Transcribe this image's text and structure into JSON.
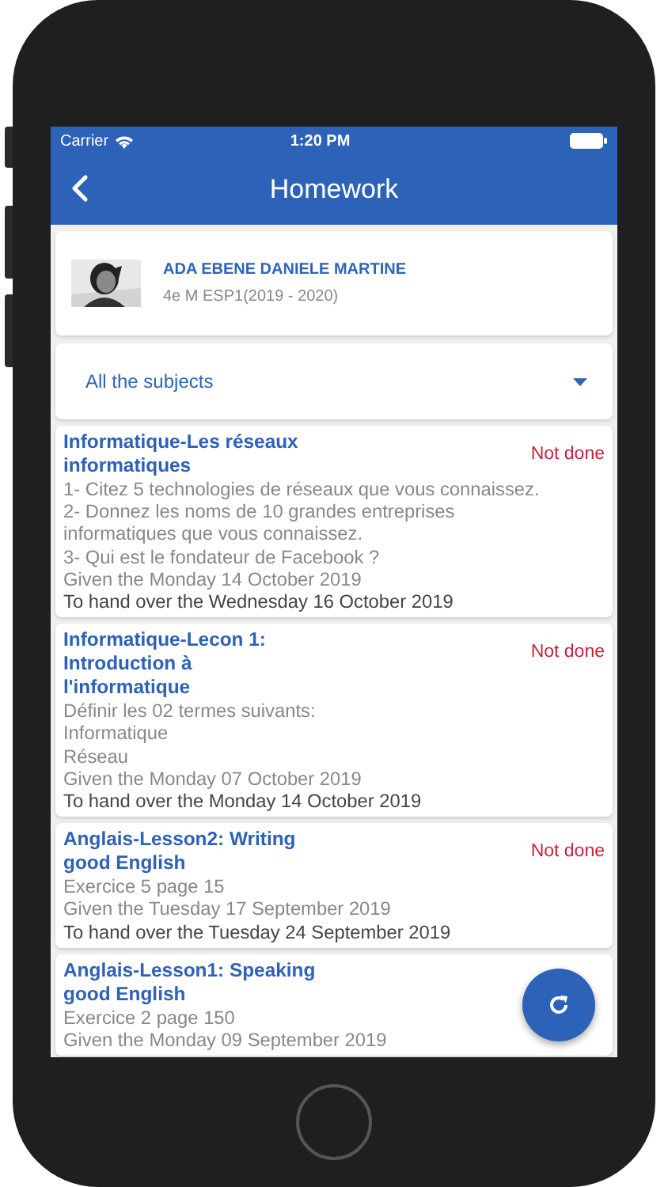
{
  "status_bar": {
    "carrier": "Carrier",
    "time": "1:20 PM"
  },
  "nav": {
    "title": "Homework"
  },
  "student": {
    "name": "ADA EBENE DANIELE MARTINE",
    "class": "4e M ESP1(2019 - 2020)"
  },
  "filter": {
    "value": "All the subjects"
  },
  "homework": [
    {
      "title": "Informatique-Les réseaux informatiques",
      "status": "Not done",
      "details": [
        "1- Citez 5 technologies de réseaux que vous connaissez.",
        "2- Donnez les noms de 10 grandes entreprises informatiques que vous connaissez.",
        "3- Qui est le fondateur de Facebook ?"
      ],
      "given": "Given the Monday 14 October 2019",
      "due": "To hand over the Wednesday 16 October 2019"
    },
    {
      "title": "Informatique-Lecon 1: Introduction à l'informatique",
      "status": "Not done",
      "details": [
        "Définir les 02 termes suivants:",
        "Informatique",
        "Réseau"
      ],
      "given": "Given the Monday 07 October 2019",
      "due": "To hand over the Monday 14 October 2019"
    },
    {
      "title": "Anglais-Lesson2: Writing good English",
      "status": "Not done",
      "details": [
        "Exercice 5 page 15"
      ],
      "given": "Given the Tuesday 17 September 2019",
      "due": "To hand over the Tuesday 24 September 2019"
    },
    {
      "title": "Anglais-Lesson1: Speaking good English",
      "details": [
        "Exercice 2 page 150"
      ],
      "given": "Given the Monday 09 September 2019"
    }
  ]
}
